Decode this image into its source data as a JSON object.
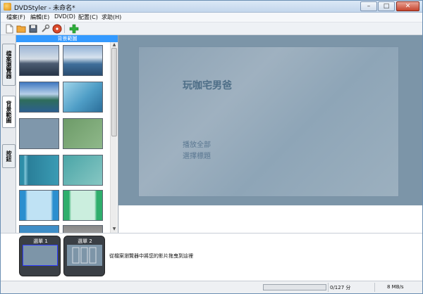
{
  "window": {
    "title": "DVDStyler - 未命名*"
  },
  "titlebar": {
    "min_glyph": "–",
    "max_glyph": "□",
    "close_glyph": "✕"
  },
  "menubar": {
    "items": [
      {
        "label": "檔案(F)"
      },
      {
        "label": "編輯(E)"
      },
      {
        "label": "DVD(D)"
      },
      {
        "label": "配置(C)"
      },
      {
        "label": "求助(H)"
      }
    ]
  },
  "toolbar": {
    "icons": [
      "new-file-icon",
      "open-folder-icon",
      "save-icon",
      "settings-wrench-icon",
      "burn-disc-icon",
      "add-plus-icon"
    ]
  },
  "left_tabs": [
    {
      "label": "檔案瀏覽器",
      "active": false
    },
    {
      "label": "背景範圖",
      "active": true
    },
    {
      "label": "按鈕",
      "active": false
    }
  ],
  "thumb_panel": {
    "header": "背景範圖"
  },
  "preview": {
    "title": "玩咖宅男爸",
    "buttons": [
      "播放全部",
      "選擇標題"
    ]
  },
  "menus": [
    {
      "label": "選單 1",
      "selected": true
    },
    {
      "label": "選單 2",
      "selected": false
    }
  ],
  "hint": "從檔案瀏覽器中將您的影片拖曳到這裡",
  "status": {
    "progress_fraction": 0.0,
    "size": "0/127 分",
    "rate": "8 MB/s"
  },
  "colors": {
    "accent": "#3399ff",
    "preview": "#8ca2b4",
    "progress": "#7bc96f"
  }
}
